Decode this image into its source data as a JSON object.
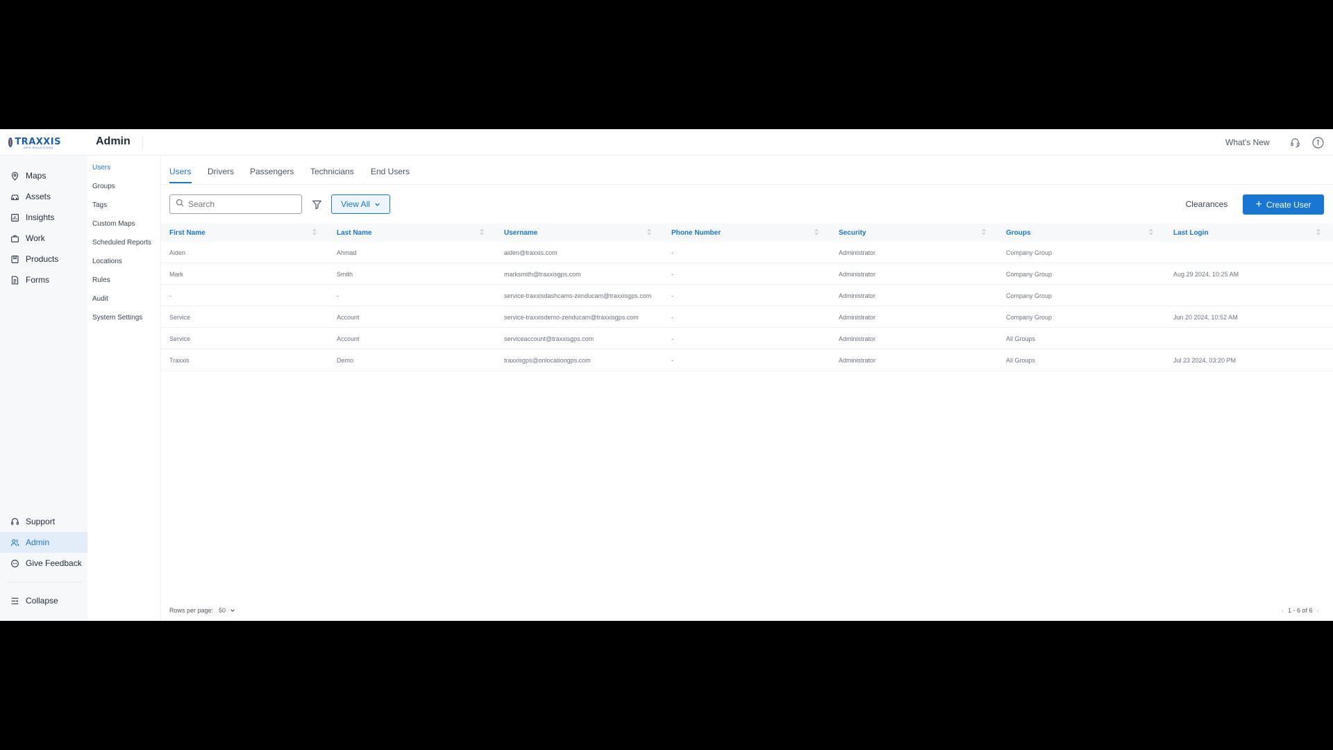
{
  "app": {
    "logo_text": "TRAXXIS",
    "logo_sub": "GPS SOLUTIONS",
    "page_title": "Admin",
    "whats_new": "What's New",
    "icons": {
      "support": "headset-icon",
      "help": "help-circle-icon"
    }
  },
  "mainnav": {
    "items": [
      {
        "label": "Maps",
        "icon": "map-pin-icon"
      },
      {
        "label": "Assets",
        "icon": "car-icon"
      },
      {
        "label": "Insights",
        "icon": "bar-chart-icon"
      },
      {
        "label": "Work",
        "icon": "briefcase-icon"
      },
      {
        "label": "Products",
        "icon": "box-icon"
      },
      {
        "label": "Forms",
        "icon": "document-icon"
      }
    ],
    "bottom": [
      {
        "label": "Support",
        "icon": "headset-icon"
      },
      {
        "label": "Admin",
        "icon": "users-icon",
        "active": true
      },
      {
        "label": "Give Feedback",
        "icon": "chat-icon"
      }
    ],
    "collapse": "Collapse"
  },
  "subnav": {
    "items": [
      "Users",
      "Groups",
      "Tags",
      "Custom Maps",
      "Scheduled Reports",
      "Locations",
      "Rules",
      "Audit",
      "System Settings"
    ],
    "active": "Users"
  },
  "tabs": [
    "Users",
    "Drivers",
    "Passengers",
    "Technicians",
    "End Users"
  ],
  "toolbar": {
    "search_placeholder": "Search",
    "view_all": "View All",
    "clearances": "Clearances",
    "create_user": "Create User"
  },
  "table": {
    "columns": [
      "First Name",
      "Last Name",
      "Username",
      "Phone Number",
      "Security",
      "Groups",
      "Last Login"
    ],
    "rows": [
      [
        "Aiden",
        "Ahmad",
        "aiden@traxxis.com",
        "-",
        "Administrator",
        "Company Group",
        ""
      ],
      [
        "Mark",
        "Smith",
        "marksmith@traxxisgps.com",
        "-",
        "Administrator",
        "Company Group",
        "Aug 29 2024, 10:25 AM"
      ],
      [
        "-",
        "-",
        "service-traxxisdashcams-zenducam@traxxisgps.com",
        "-",
        "Administrator",
        "Company Group",
        ""
      ],
      [
        "Service",
        "Account",
        "service-traxxisdemo-zenducam@traxxisgps.com",
        "-",
        "Administrator",
        "Company Group",
        "Jun 20 2024, 10:52 AM"
      ],
      [
        "Service",
        "Account",
        "serviceaccount@traxxisgps.com",
        "-",
        "Administrator",
        "All Groups",
        ""
      ],
      [
        "Traxxis",
        "Demo",
        "traxxisgps@onlocationgps.com",
        "-",
        "Administrator",
        "All Groups",
        "Jul 23 2024, 03:20 PM"
      ]
    ]
  },
  "footer": {
    "rows_per_page_label": "Rows per page:",
    "rows_per_page_value": "50",
    "range": "1 - 6 of 6"
  },
  "colors": {
    "accent": "#1976d2",
    "nav_bg": "#f7f8fa",
    "active_bg": "#e3edf9"
  }
}
